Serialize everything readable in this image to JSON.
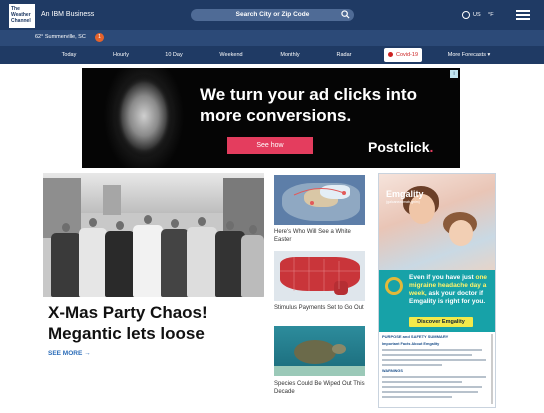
{
  "header": {
    "logo_text": "The Weather Channel",
    "brand_tag": "An IBM Business",
    "search_placeholder": "Search City or Zip Code",
    "locale": "US",
    "unit": "°F",
    "icons": [
      "search-icon",
      "globe-icon",
      "menu-icon"
    ]
  },
  "location": {
    "text": "62° Summerville, SC",
    "alert_count": "1"
  },
  "nav": {
    "items": [
      "Today",
      "Hourly",
      "10 Day",
      "Weekend",
      "Monthly",
      "Radar",
      "Covid-19",
      "More Forecasts"
    ]
  },
  "ad": {
    "headline": "We turn your ad clicks into more conversions.",
    "cta": "See how",
    "brand": "Postclick",
    "brand_dot": "."
  },
  "feature": {
    "title": "X-Mas Party Chaos! Megantic lets loose",
    "see_more": "SEE MORE →"
  },
  "stories": [
    {
      "caption": "Here's Who Will See a White Easter"
    },
    {
      "caption": "Stimulus Payments Set to Go Out"
    },
    {
      "caption": "Species Could Be Wiped Out This Decade"
    }
  ],
  "side_ad": {
    "brand": "Emgality",
    "brand_sub": "(galcanezumab-gnlm)",
    "pitch_line1": "Even if you have just",
    "pitch_highlight": "one migraine headache day a week,",
    "pitch_line2": "ask your doctor if Emgality is right for you.",
    "cta": "Discover Emgality",
    "info_title": "PURPOSE and SAFETY SUMMARY",
    "info_sub": "Important Facts About Emgality",
    "warnings_label": "WARNINGS",
    "colors": {
      "teal": "#17a2a8",
      "highlight": "#fff36b",
      "button": "#f3ea4a"
    }
  },
  "colors": {
    "header_bg": "#1f3a64",
    "locbar_bg": "#2c4a78",
    "accent_link": "#2b6cb8",
    "ad_cta": "#e43d5e"
  }
}
